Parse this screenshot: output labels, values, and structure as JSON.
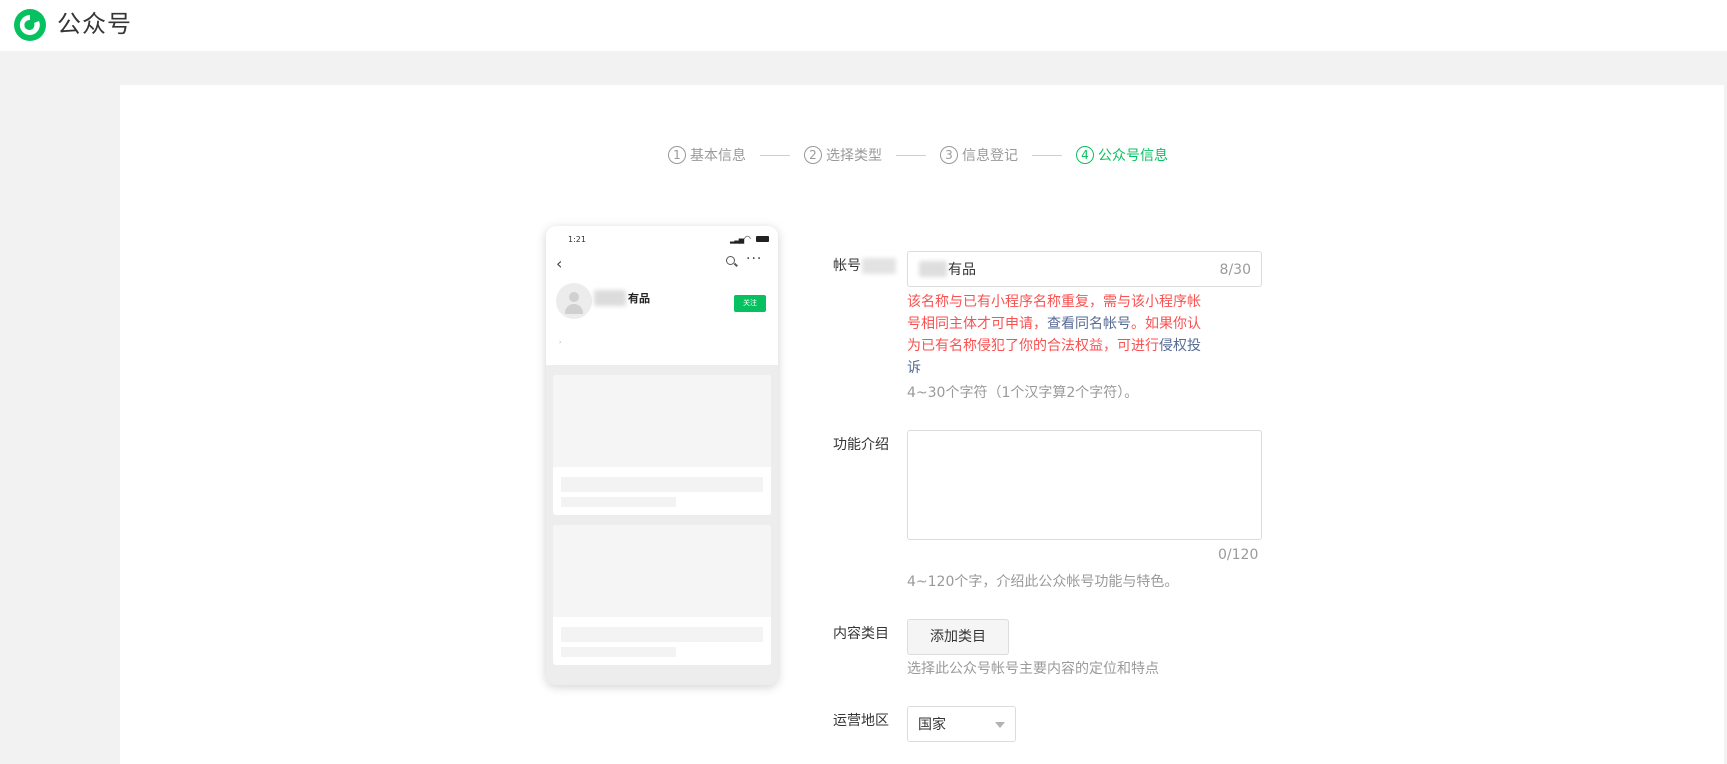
{
  "header": {
    "brand": "公众号",
    "logo_icon": "wechat-official-account-logo",
    "accent": "#07c160"
  },
  "steps": [
    {
      "num": "1",
      "label": "基本信息",
      "active": false
    },
    {
      "num": "2",
      "label": "选择类型",
      "active": false
    },
    {
      "num": "3",
      "label": "信息登记",
      "active": false
    },
    {
      "num": "4",
      "label": "公众号信息",
      "active": true
    }
  ],
  "preview": {
    "time": "1:21",
    "name": "有品",
    "follow_label": "关注",
    "dot": "›"
  },
  "form": {
    "name": {
      "label": "帐号",
      "value": "有品",
      "count": "8/30",
      "error_part1": "该名称与已有小程序名称重复，需与该小程序帐号相同主体才可申请，",
      "error_link1": "查看同名帐号",
      "error_part2": "。如果你认为已有名称侵犯了你的合法权益，可进行",
      "error_link2": "侵权投诉",
      "hint": "4~30个字符（1个汉字算2个字符）。"
    },
    "intro": {
      "label": "功能介绍",
      "count": "0/120",
      "hint": "4~120个字，介绍此公众帐号功能与特色。"
    },
    "category": {
      "label": "内容类目",
      "button": "添加类目",
      "hint": "选择此公众号帐号主要内容的定位和特点"
    },
    "region": {
      "label": "运营地区",
      "value": "国家"
    }
  },
  "colors": {
    "error": "#fa5151",
    "link": "#576b95",
    "hint": "#9a9a9a"
  }
}
